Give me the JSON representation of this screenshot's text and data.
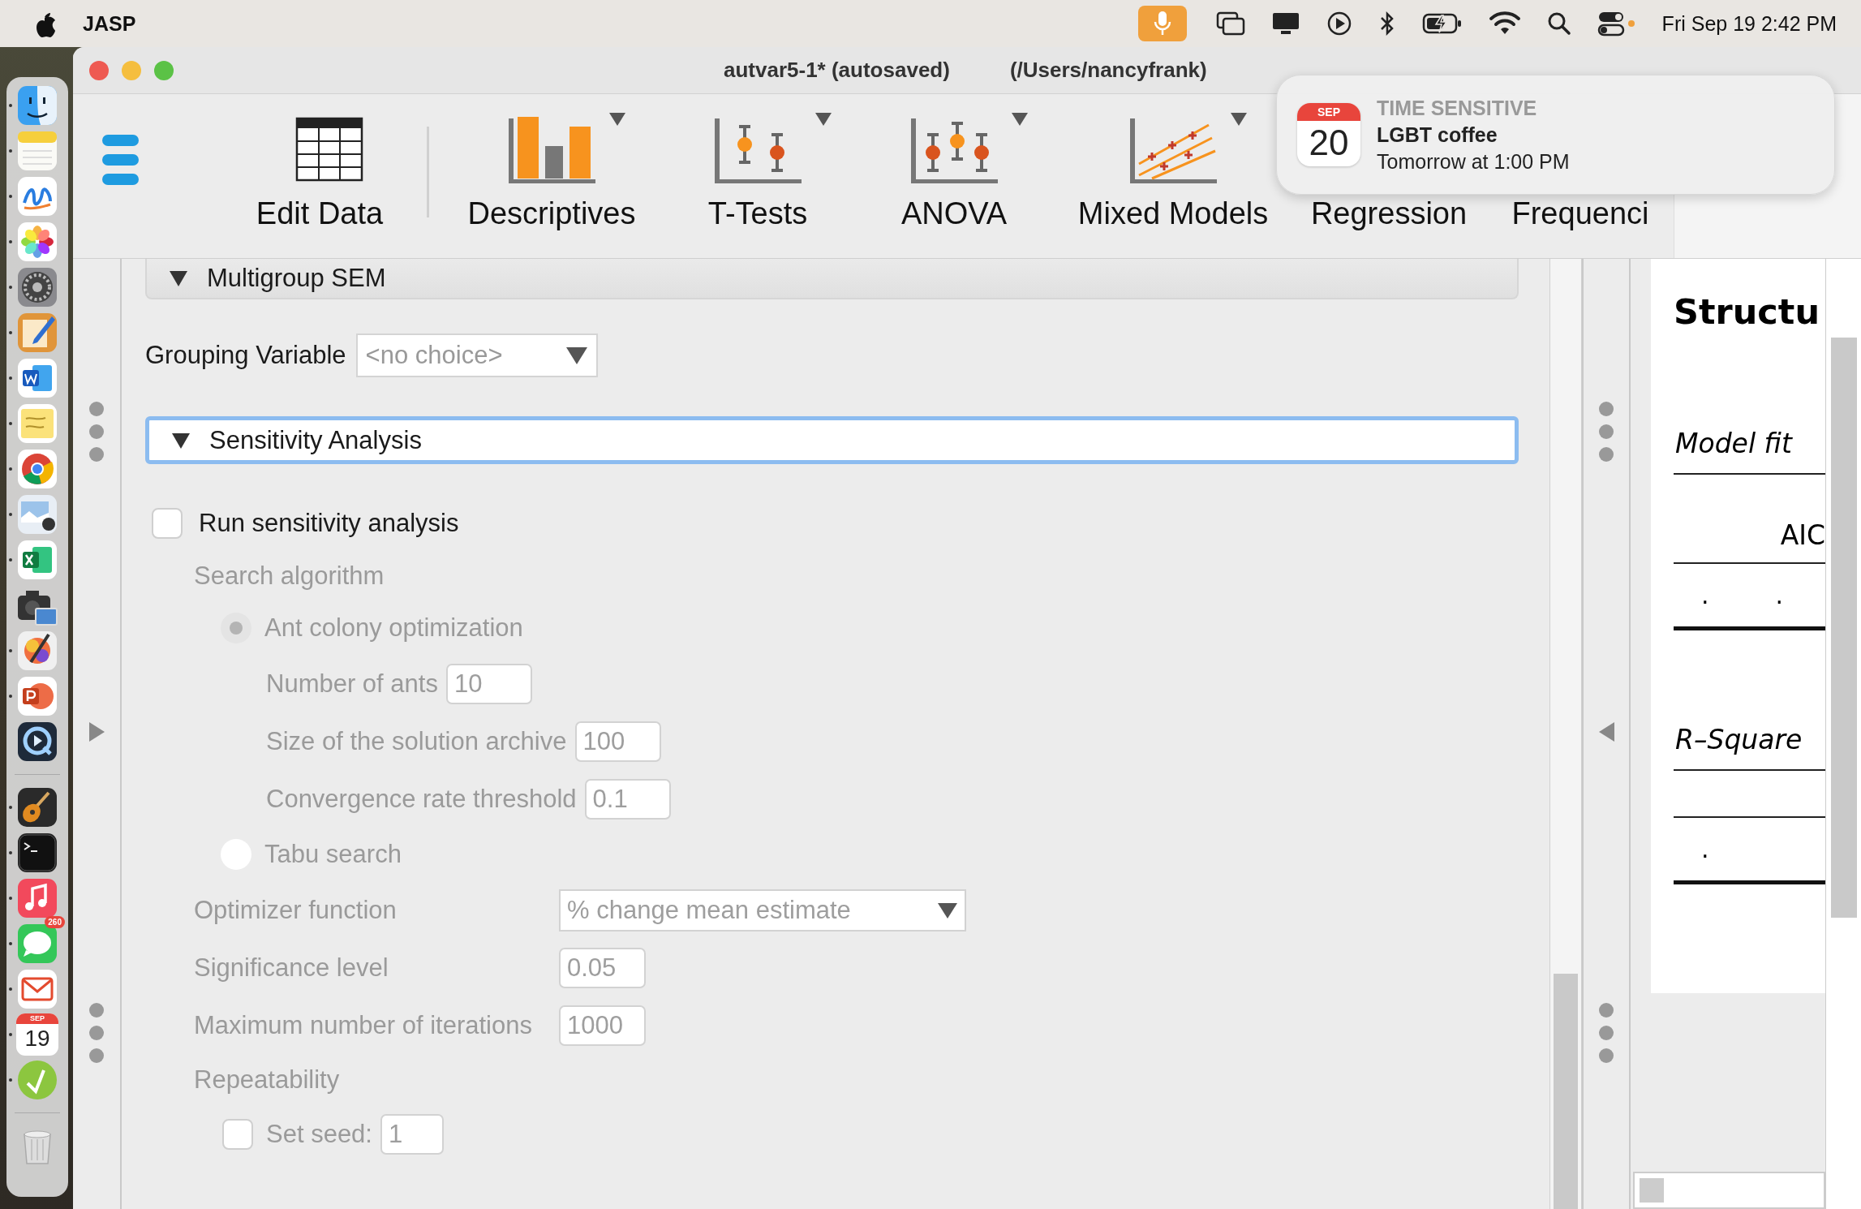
{
  "menu_bar": {
    "app_name": "JASP",
    "clock": "Fri Sep 19  2:42 PM"
  },
  "dock": {
    "items": [
      {
        "kind": "finder",
        "running": true
      },
      {
        "kind": "notes",
        "running": true
      },
      {
        "kind": "freeform",
        "running": true
      },
      {
        "kind": "photos",
        "running": true
      },
      {
        "kind": "settings",
        "running": true
      },
      {
        "kind": "pencil",
        "running": true
      },
      {
        "kind": "word",
        "running": true
      },
      {
        "kind": "stickies",
        "running": true
      },
      {
        "kind": "browser",
        "running": true
      },
      {
        "kind": "preview",
        "running": true
      },
      {
        "kind": "excel",
        "running": true
      },
      {
        "kind": "camera",
        "running": false
      },
      {
        "kind": "brush",
        "running": true
      },
      {
        "kind": "powerpoint",
        "running": true
      },
      {
        "kind": "quicktime",
        "running": false
      },
      {
        "kind": "separator"
      },
      {
        "kind": "guitar",
        "running": true
      },
      {
        "kind": "terminal",
        "running": true
      },
      {
        "kind": "music",
        "running": true
      },
      {
        "kind": "messages",
        "running": true,
        "badge": "260"
      },
      {
        "kind": "mail",
        "running": true
      },
      {
        "kind": "calendar",
        "running": true,
        "month": "SEP",
        "day": "19"
      },
      {
        "kind": "jasp",
        "running": true
      },
      {
        "kind": "separator"
      },
      {
        "kind": "trash",
        "running": false
      }
    ]
  },
  "window": {
    "title": "autvar5-1* (autosaved)",
    "path": "(/Users/nancyfrank)"
  },
  "toolbar": {
    "items": [
      {
        "label": "Edit Data",
        "kind": "table",
        "menu": false
      },
      {
        "label": "Descriptives",
        "kind": "bars",
        "menu": true
      },
      {
        "label": "T-Tests",
        "kind": "ttest",
        "menu": true
      },
      {
        "label": "ANOVA",
        "kind": "anova",
        "menu": true
      },
      {
        "label": "Mixed Models",
        "kind": "mixed",
        "menu": true
      },
      {
        "label": "Regression",
        "menu": false
      },
      {
        "label": "Frequenci",
        "menu": false
      }
    ]
  },
  "notification": {
    "month": "SEP",
    "day": "20",
    "heading": "TIME SENSITIVE",
    "title": "LGBT coffee",
    "time": "Tomorrow at 1:00 PM"
  },
  "form": {
    "sections": [
      {
        "title": "Multigroup SEM",
        "expanded": true,
        "focused": false
      },
      {
        "title": "Sensitivity Analysis",
        "expanded": true,
        "focused": true
      }
    ],
    "grouping": {
      "label": "Grouping Variable",
      "placeholder": "<no choice>"
    },
    "run_checkbox": {
      "label": "Run sensitivity analysis",
      "checked": false
    },
    "options": {
      "disabled": true,
      "items": [
        {
          "kind": "group",
          "label": "Search algorithm",
          "children": [
            {
              "kind": "radio",
              "label": "Ant colony optimization",
              "selected": true,
              "children": [
                {
                  "kind": "field",
                  "label": "Number of ants",
                  "value": "10"
                },
                {
                  "kind": "field",
                  "label": "Size of the solution archive",
                  "value": "100"
                },
                {
                  "kind": "field",
                  "label": "Convergence rate threshold",
                  "value": "0.1"
                }
              ]
            },
            {
              "kind": "radio",
              "label": "Tabu search",
              "selected": false
            }
          ]
        },
        {
          "kind": "dropdown",
          "label": "Optimizer function",
          "value": "% change mean estimate"
        },
        {
          "kind": "field",
          "label": "Significance level",
          "value": "0.05"
        },
        {
          "kind": "field",
          "label": "Maximum number of iterations",
          "value": "1000"
        },
        {
          "kind": "group",
          "label": "Repeatability",
          "children": [
            {
              "kind": "checkfield",
              "label": "Set seed:",
              "checked": false,
              "value": "1"
            }
          ]
        }
      ]
    }
  },
  "results": {
    "title": "Structu",
    "tables": [
      {
        "title": "Model fit",
        "header": "AIC",
        "cells": [
          ".",
          "."
        ]
      },
      {
        "title": "R–Square",
        "cells": [
          "."
        ]
      }
    ]
  }
}
